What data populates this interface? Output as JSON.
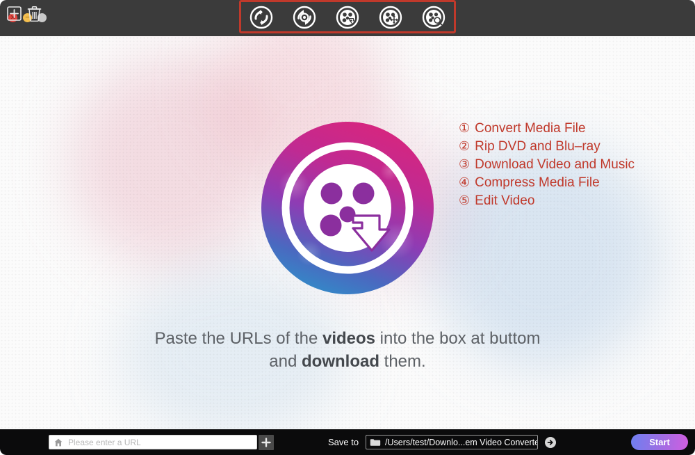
{
  "window": {
    "controls": [
      {
        "name": "close",
        "glyph": "×",
        "color": "#e0443e"
      },
      {
        "name": "minimize",
        "glyph": "−",
        "color": "#f5bf4f"
      },
      {
        "name": "zoom",
        "glyph": "",
        "color": "#c9c9c9"
      }
    ]
  },
  "toolbar": {
    "highlight_color": "#c0392b",
    "buttons": [
      {
        "number": "①",
        "icon": "convert-icon",
        "title": "Convert Media File"
      },
      {
        "number": "②",
        "icon": "rip-disc-icon",
        "title": "Rip DVD and Blu–ray"
      },
      {
        "number": "③",
        "icon": "download-reel-icon",
        "title": "Download Video and Music"
      },
      {
        "number": "④",
        "icon": "compress-reel-icon",
        "title": "Compress Media File"
      },
      {
        "number": "⑤",
        "icon": "edit-reel-icon",
        "title": "Edit Video"
      }
    ]
  },
  "features": {
    "color": "#c0392b",
    "items": [
      {
        "number": "①",
        "label": "Convert Media File"
      },
      {
        "number": "②",
        "label": "Rip DVD and Blu–ray"
      },
      {
        "number": "③",
        "label": "Download Video and Music"
      },
      {
        "number": "④",
        "label": "Compress Media File"
      },
      {
        "number": "⑤",
        "label": "Edit Video"
      }
    ]
  },
  "hint": {
    "line1_prefix": "Paste the URLs of the ",
    "line1_bold": "videos",
    "line1_suffix": " into the box at buttom",
    "line2_prefix": "and ",
    "line2_bold": "download",
    "line2_suffix": " them."
  },
  "logo": {
    "name": "video-converter-logo",
    "gradient_from": "#cc2a8e",
    "gradient_mid": "#9b3ab4",
    "gradient_to": "#2f7fc4"
  },
  "bottom_bar": {
    "add_icon": "plus-box-icon",
    "delete_icon": "trash-icon",
    "url": {
      "value": "",
      "placeholder": "Please enter a URL",
      "home_icon": "home-icon",
      "add_icon": "plus-icon"
    },
    "save_to_label": "Save to",
    "save_path": "/Users/test/Downlo...em Video Converter",
    "folder_icon": "folder-icon",
    "open_icon": "arrow-right-circle-icon",
    "start_label": "Start"
  }
}
